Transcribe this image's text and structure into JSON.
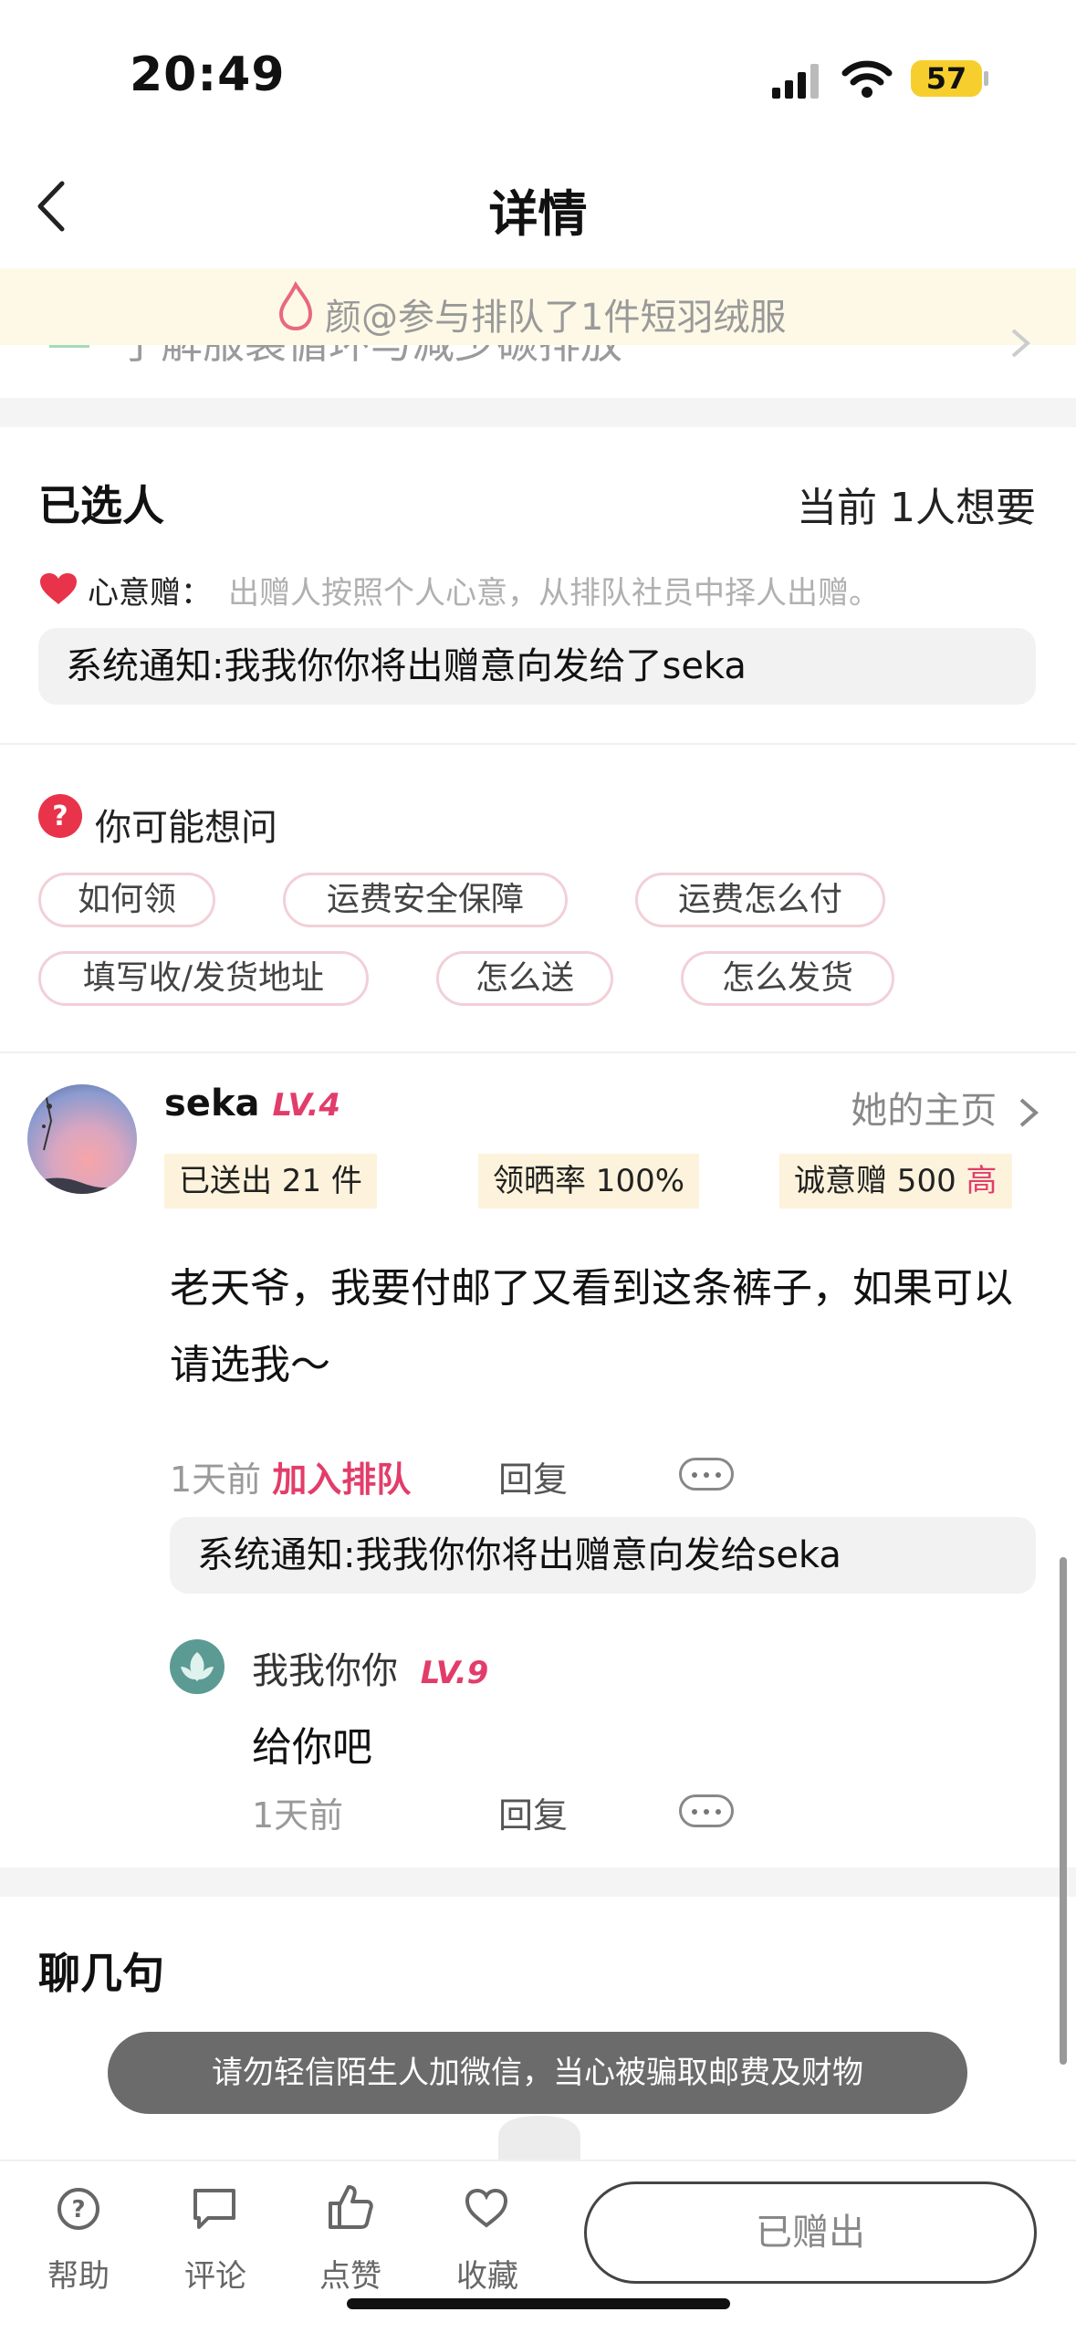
{
  "status_bar": {
    "time": "20:49",
    "battery": "57"
  },
  "nav": {
    "title": "详情"
  },
  "banner": {
    "notice": "颜@参与排队了1件短羽绒服",
    "underlying": "了解服装循环与减少碳排放"
  },
  "selected": {
    "title": "已选人",
    "count": "当前 1人想要",
    "tip_label": "心意赠：",
    "tip_text": "出赠人按照个人心意，从排队社员中择人出赠。",
    "system_notice": "系统通知:我我你你将出赠意向发给了seka"
  },
  "faq": {
    "title": "你可能想问",
    "chips": [
      "如何领",
      "运费安全保障",
      "运费怎么付",
      "填写收/发货地址",
      "怎么送",
      "怎么发货"
    ]
  },
  "comment": {
    "username": "seka",
    "level": "LV.4",
    "home_link": "她的主页",
    "stats": [
      "已送出 21 件",
      "领晒率 100%",
      "诚意赠 500"
    ],
    "stat_high": "高",
    "text": "老天爷，我要付邮了又看到这条裤子，如果可以请选我～",
    "time": "1天前",
    "join": "加入排队",
    "reply": "回复",
    "system_notice": "系统通知:我我你你将出赠意向发给seka",
    "sub_reply": {
      "username": "我我你你",
      "level": "LV.9",
      "text": "给你吧",
      "time": "1天前",
      "reply": "回复"
    }
  },
  "chat": {
    "title": "聊几句"
  },
  "toast": "请勿轻信陌生人加微信，当心被骗取邮费及财物",
  "bottom_bar": {
    "help": "帮助",
    "comment": "评论",
    "like": "点赞",
    "favorite": "收藏",
    "gifted": "已赠出"
  }
}
